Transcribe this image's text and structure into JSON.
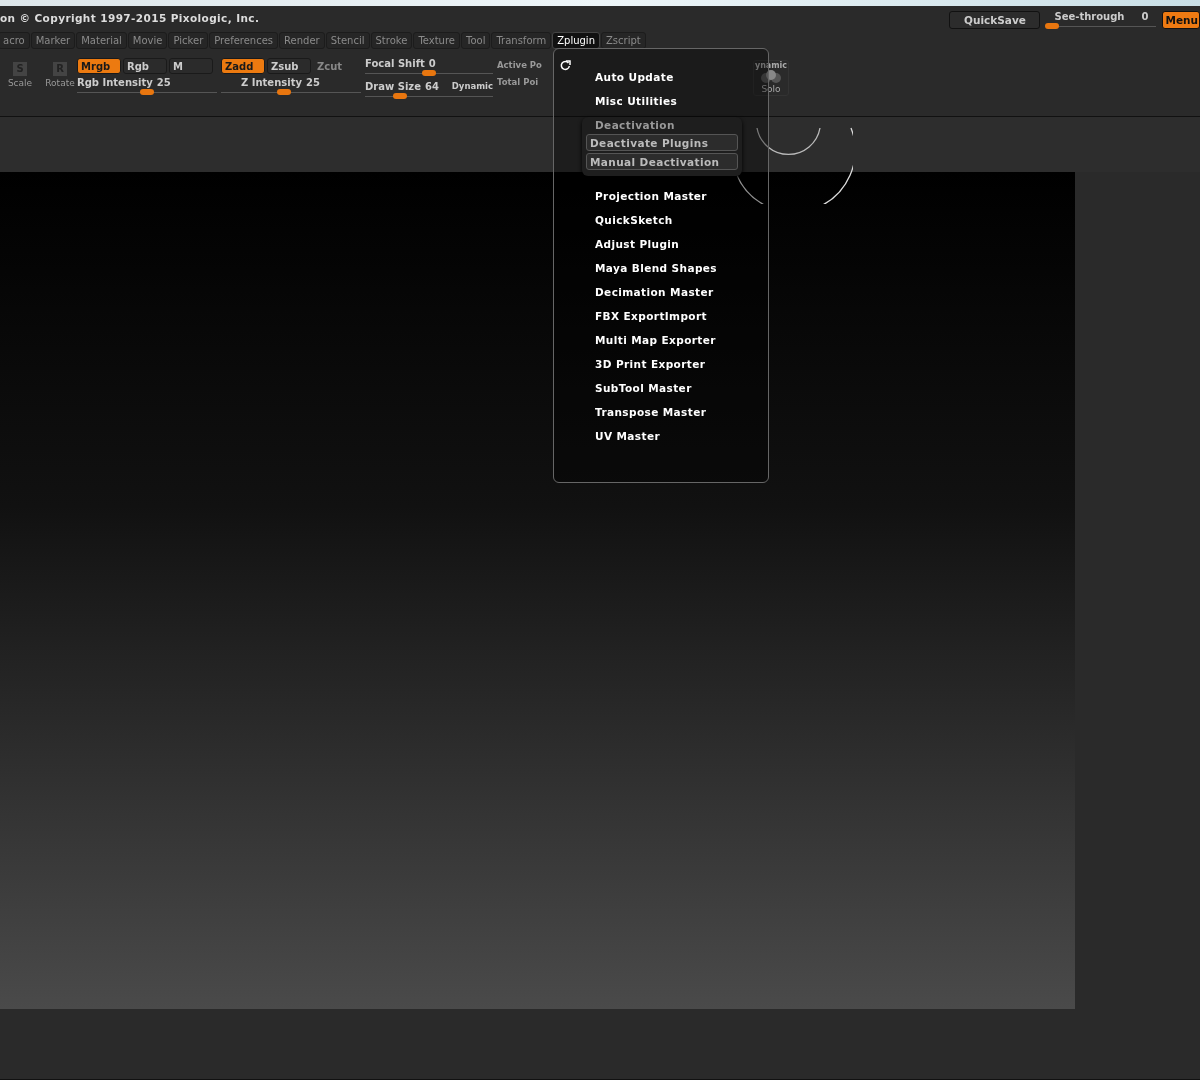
{
  "title": "on © Copyright 1997-2015 Pixologic, Inc.",
  "top_right": {
    "quicksave": "QuickSave",
    "see_through": {
      "label": "See-through",
      "value": "0",
      "level": 0.05
    },
    "menu_button": "Menu"
  },
  "menu_tabs": [
    {
      "label": "acro",
      "selected": false
    },
    {
      "label": "Marker",
      "selected": false
    },
    {
      "label": "Material",
      "selected": false
    },
    {
      "label": "Movie",
      "selected": false
    },
    {
      "label": "Picker",
      "selected": false
    },
    {
      "label": "Preferences",
      "selected": false
    },
    {
      "label": "Render",
      "selected": false
    },
    {
      "label": "Stencil",
      "selected": false
    },
    {
      "label": "Stroke",
      "selected": false
    },
    {
      "label": "Texture",
      "selected": false
    },
    {
      "label": "Tool",
      "selected": false
    },
    {
      "label": "Transform",
      "selected": false
    },
    {
      "label": "Zplugin",
      "selected": true
    },
    {
      "label": "Zscript",
      "selected": false
    }
  ],
  "tool_buttons": [
    {
      "label": "Scale",
      "glyph": "S",
      "disabled": true
    },
    {
      "label": "Rotate",
      "glyph": "R",
      "disabled": true
    }
  ],
  "toggles_left": [
    {
      "label": "Mrgb",
      "on": true,
      "disabled": false
    },
    {
      "label": "Rgb",
      "on": false,
      "disabled": false
    },
    {
      "label": "M",
      "on": false,
      "disabled": false
    }
  ],
  "toggles_right": [
    {
      "label": "Zadd",
      "on": true,
      "disabled": false
    },
    {
      "label": "Zsub",
      "on": false,
      "disabled": false
    },
    {
      "label": "Zcut",
      "on": false,
      "disabled": true
    }
  ],
  "sliders": [
    {
      "label": "Rgb Intensity",
      "value": "25",
      "level": 0.5
    },
    {
      "label": "Z Intensity",
      "value": "25",
      "level": 0.45
    },
    {
      "label": "Focal Shift",
      "value": "0",
      "level": 0.5
    },
    {
      "label": "Draw Size",
      "value": "64",
      "level": 0.27
    }
  ],
  "dynamic_label": "Dynamic",
  "point_counts": [
    "Active Po",
    "Total Poi"
  ],
  "solo": {
    "top": "ynamic",
    "label": "Solo"
  },
  "zplugin_menu": {
    "items_top": [
      "Auto Update",
      "Misc Utilities"
    ],
    "deactivation": {
      "title": "Deactivation",
      "buttons": [
        "Deactivate Plugins",
        "Manual Deactivation"
      ]
    },
    "items": [
      "Projection Master",
      "QuickSketch",
      "Adjust Plugin",
      "Maya Blend Shapes",
      "Decimation Master",
      "FBX ExportImport",
      "Multi Map Exporter",
      "3D Print Exporter",
      "SubTool Master",
      "Transpose Master",
      "UV Master"
    ]
  }
}
